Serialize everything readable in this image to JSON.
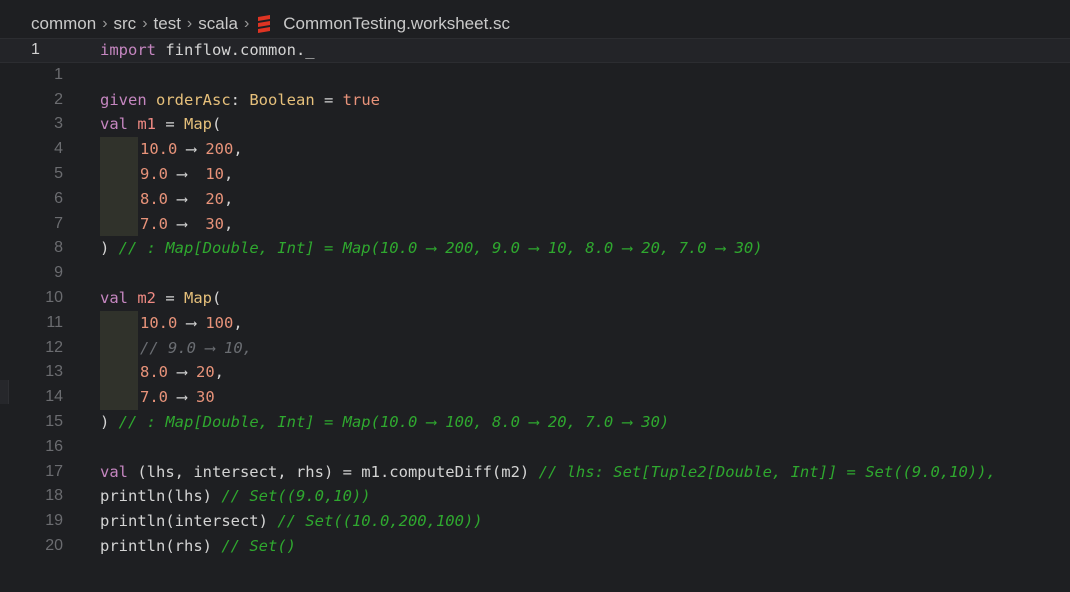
{
  "breadcrumb": {
    "items": [
      "common",
      "src",
      "test",
      "scala"
    ],
    "file": "CommonTesting.worksheet.sc",
    "file_icon": "scala-icon"
  },
  "lines": [
    {
      "n": "1",
      "current": true,
      "tokens": [
        [
          "kwv",
          "import"
        ],
        [
          "id",
          " finflow.common._"
        ]
      ]
    },
    {
      "n": "1",
      "tokens": []
    },
    {
      "n": "2",
      "tokens": [
        [
          "kwv",
          "given "
        ],
        [
          "ty",
          "orderAsc"
        ],
        [
          "id",
          ": "
        ],
        [
          "ty",
          "Boolean"
        ],
        [
          "id",
          " = "
        ],
        [
          "num",
          "true"
        ]
      ]
    },
    {
      "n": "3",
      "tokens": [
        [
          "kwv",
          "val "
        ],
        [
          "var",
          "m1"
        ],
        [
          "id",
          " = "
        ],
        [
          "ty",
          "Map"
        ],
        [
          "id",
          "("
        ]
      ]
    },
    {
      "n": "4",
      "indent": true,
      "tokens": [
        [
          "num",
          "10.0"
        ],
        [
          "arr",
          " ⟶ "
        ],
        [
          "num",
          "200"
        ],
        [
          "id",
          ","
        ]
      ]
    },
    {
      "n": "5",
      "indent": true,
      "tokens": [
        [
          "num",
          "9.0"
        ],
        [
          "arr",
          " ⟶  "
        ],
        [
          "num",
          "10"
        ],
        [
          "id",
          ","
        ]
      ]
    },
    {
      "n": "6",
      "indent": true,
      "tokens": [
        [
          "num",
          "8.0"
        ],
        [
          "arr",
          " ⟶  "
        ],
        [
          "num",
          "20"
        ],
        [
          "id",
          ","
        ]
      ]
    },
    {
      "n": "7",
      "indent": true,
      "tokens": [
        [
          "num",
          "7.0"
        ],
        [
          "arr",
          " ⟶  "
        ],
        [
          "num",
          "30"
        ],
        [
          "id",
          ","
        ]
      ]
    },
    {
      "n": "8",
      "tokens": [
        [
          "id",
          ") "
        ],
        [
          "cm",
          "// : Map[Double, Int] = Map(10.0 ⟶ 200, 9.0 ⟶ 10, 8.0 ⟶ 20, 7.0 ⟶ 30)"
        ]
      ]
    },
    {
      "n": "9",
      "tokens": []
    },
    {
      "n": "10",
      "tokens": [
        [
          "kwv",
          "val "
        ],
        [
          "var",
          "m2"
        ],
        [
          "id",
          " = "
        ],
        [
          "ty",
          "Map"
        ],
        [
          "id",
          "("
        ]
      ]
    },
    {
      "n": "11",
      "indent": true,
      "tokens": [
        [
          "num",
          "10.0"
        ],
        [
          "arr",
          " ⟶ "
        ],
        [
          "num",
          "100"
        ],
        [
          "id",
          ","
        ]
      ]
    },
    {
      "n": "12",
      "indent": true,
      "tokens": [
        [
          "cm-grey",
          "// 9.0 ⟶ 10,"
        ]
      ]
    },
    {
      "n": "13",
      "indent": true,
      "tokens": [
        [
          "num",
          "8.0"
        ],
        [
          "arr",
          " ⟶ "
        ],
        [
          "num",
          "20"
        ],
        [
          "id",
          ","
        ]
      ]
    },
    {
      "n": "14",
      "indent": true,
      "tokens": [
        [
          "num",
          "7.0"
        ],
        [
          "arr",
          " ⟶ "
        ],
        [
          "num",
          "30"
        ]
      ]
    },
    {
      "n": "15",
      "tokens": [
        [
          "id",
          ") "
        ],
        [
          "cm",
          "// : Map[Double, Int] = Map(10.0 ⟶ 100, 8.0 ⟶ 20, 7.0 ⟶ 30)"
        ]
      ]
    },
    {
      "n": "16",
      "tokens": []
    },
    {
      "n": "17",
      "tokens": [
        [
          "kwv",
          "val "
        ],
        [
          "id",
          "(lhs, intersect, rhs) = m1.computeDiff(m2) "
        ],
        [
          "cm",
          "// lhs: Set[Tuple2[Double, Int]] = Set((9.0,10)),"
        ]
      ]
    },
    {
      "n": "18",
      "tokens": [
        [
          "id",
          "println(lhs) "
        ],
        [
          "cm",
          "// Set((9.0,10))"
        ]
      ]
    },
    {
      "n": "19",
      "tokens": [
        [
          "id",
          "println(intersect) "
        ],
        [
          "cm",
          "// Set((10.0,200,100))"
        ]
      ]
    },
    {
      "n": "20",
      "tokens": [
        [
          "id",
          "println(rhs) "
        ],
        [
          "cm",
          "// Set()"
        ]
      ]
    }
  ]
}
